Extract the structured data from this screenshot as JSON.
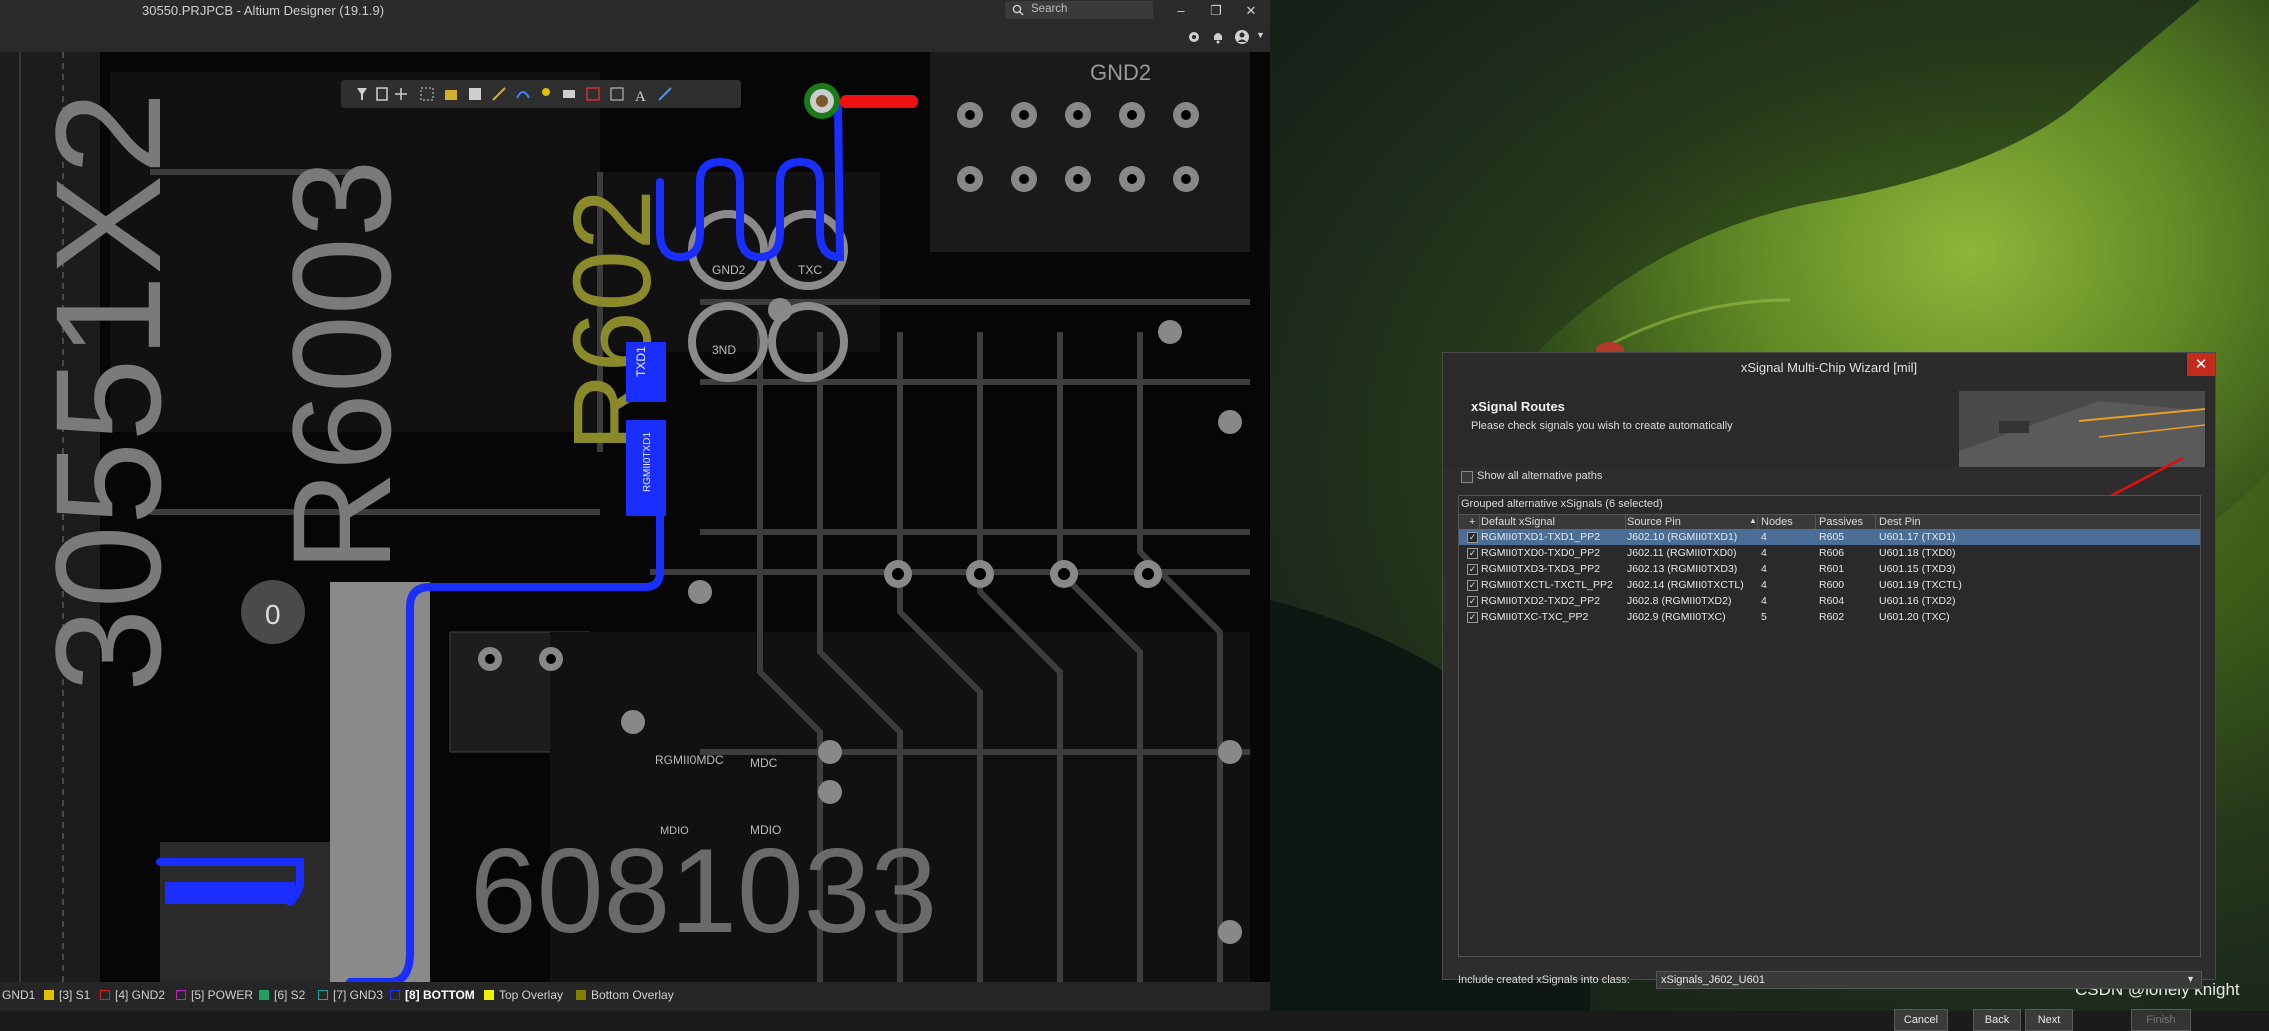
{
  "app": {
    "title": "30550.PRJPCB - Altium Designer (19.1.9)",
    "search_placeholder": "Search",
    "layers": [
      {
        "label": "GND1",
        "color": "#bdbdbd"
      },
      {
        "label": "[3] S1",
        "color": "#e0c000"
      },
      {
        "label": "[4] GND2",
        "color": "#d02020"
      },
      {
        "label": "[5] POWER",
        "color": "#c020c0"
      },
      {
        "label": "[6] S2",
        "color": "#20a060"
      },
      {
        "label": "[7] GND3",
        "color": "#20a0a0"
      },
      {
        "label": "[8] BOTTOM",
        "color": "#2030ff"
      },
      {
        "label": "Top Overlay",
        "color": "#f0f000"
      },
      {
        "label": "Bottom Overlay",
        "color": "#808000"
      }
    ],
    "active_layer": "[8] BOTTOM",
    "pcb_labels": {
      "gnd2_top": "GND2",
      "pad_gnd2": "GND2",
      "pad_txc": "TXC",
      "pad_3ndt": "3ND",
      "comp_txd1_a": "TXD1",
      "comp_txd1_b": "RGMII0TXD1",
      "mdc": "MDC",
      "mdio": "MDIO",
      "rgmii0mdc": "RGMII0MDC",
      "mdio_bottom": "MDIO",
      "circle_zero": "0",
      "big_text_left": "30551X2",
      "big_text_mid": "R6003",
      "big_text_yel": "R602",
      "big_text_row": "6081033"
    }
  },
  "dialog": {
    "title": "xSignal Multi-Chip Wizard [mil]",
    "heading": "xSignal Routes",
    "subheading": "Please check signals you wish to create automatically",
    "show_alt_label": "Show all alternative paths",
    "show_alt_checked": false,
    "group_caption": "Grouped alternative xSignals (6 selected)",
    "columns": [
      "+",
      "Default xSignal",
      "Source Pin",
      "Nodes",
      "Passives",
      "Dest Pin"
    ],
    "rows": [
      {
        "checked": true,
        "signal": "RGMII0TXD1-TXD1_PP2",
        "source": "J602.10 (RGMII0TXD1)",
        "nodes": "4",
        "passives": "R605",
        "dest": "U601.17 (TXD1)",
        "selected": true
      },
      {
        "checked": true,
        "signal": "RGMII0TXD0-TXD0_PP2",
        "source": "J602.11 (RGMII0TXD0)",
        "nodes": "4",
        "passives": "R606",
        "dest": "U601.18 (TXD0)",
        "selected": false
      },
      {
        "checked": true,
        "signal": "RGMII0TXD3-TXD3_PP2",
        "source": "J602.13 (RGMII0TXD3)",
        "nodes": "4",
        "passives": "R601",
        "dest": "U601.15 (TXD3)",
        "selected": false
      },
      {
        "checked": true,
        "signal": "RGMII0TXCTL-TXCTL_PP2",
        "source": "J602.14 (RGMII0TXCTL)",
        "nodes": "4",
        "passives": "R600",
        "dest": "U601.19 (TXCTL)",
        "selected": false
      },
      {
        "checked": true,
        "signal": "RGMII0TXD2-TXD2_PP2",
        "source": "J602.8 (RGMII0TXD2)",
        "nodes": "4",
        "passives": "R604",
        "dest": "U601.16 (TXD2)",
        "selected": false
      },
      {
        "checked": true,
        "signal": "RGMII0TXC-TXC_PP2",
        "source": "J602.9 (RGMII0TXC)",
        "nodes": "5",
        "passives": "R602",
        "dest": "U601.20 (TXC)",
        "selected": false
      }
    ],
    "class_label": "Include created xSignals into class:",
    "class_value": "xSignals_J602_U601",
    "buttons": {
      "cancel": "Cancel",
      "back": "Back",
      "next": "Next",
      "finish": "Finish"
    }
  },
  "watermark": "CSDN @lonely knight",
  "colors": {
    "selection": "#4a6e96",
    "close": "#c42b1c",
    "trace": "#1a2fff",
    "annotation_arrow": "#e01010"
  }
}
